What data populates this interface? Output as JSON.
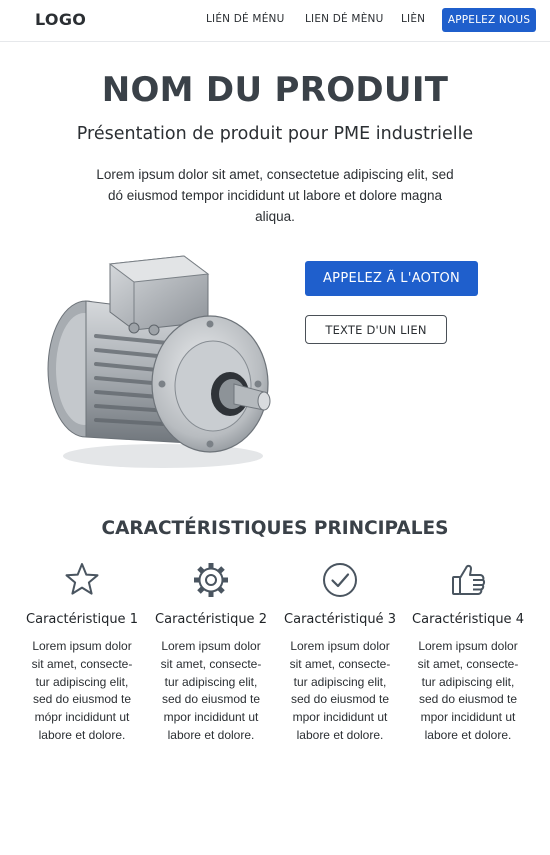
{
  "nav": {
    "logo": "LOGO",
    "links": [
      "LIÉN DÉ MÉNU",
      "LIEN DÉ MÈNU",
      "LIÈN"
    ],
    "cta": "APPELEZ NOUS"
  },
  "hero": {
    "title": "NOM DU PRODUIT",
    "subtitle": "Présentation de produit pour PME industrielle",
    "description": "Lorem ipsum dolor sit amet, consectetue adipiscing elit, sed dó eiusmod tempor incididunt ut labore et dolore magna aliqua.",
    "primary_button": "APPELEZ Ã L'AOTON",
    "secondary_button": "TEXTE D'UN LIEN",
    "image": "electric-motor"
  },
  "features": {
    "heading": "CARACTÉRISTIQUES PRINCIPALES",
    "items": [
      {
        "icon": "star-icon",
        "title": "Caractéristique 1",
        "text": "Lorem ipsum dolor sit amet, consecte-tur adipiscing elit, sed do eiusmod te mópr incididunt ut labore et dolore."
      },
      {
        "icon": "gear-icon",
        "title": "Caractéristique 2",
        "text": "Lorem ipsum dolor sit amet, consecte-tur adipiscing elit, sed do eiusmod te mpor incididunt ut labore et dolore."
      },
      {
        "icon": "check-circle-icon",
        "title": "Caractéristiqué 3",
        "text": "Lorem ipsum dolor sit amet, consecte-tur adipiscing elit, sed do eiusmod te mpor incididunt ut labore et dolore."
      },
      {
        "icon": "thumbs-up-icon",
        "title": "Caractéristique 4",
        "text": "Lorem ipsum dolor sit amet, consecte-tur adipiscing elit, sed do eiusmod te mpor incididunt ut labore et dolore."
      }
    ]
  },
  "colors": {
    "accent": "#1f5fcc",
    "heading": "#3a4148",
    "text": "#2b2f33",
    "icon": "#4a5560"
  }
}
